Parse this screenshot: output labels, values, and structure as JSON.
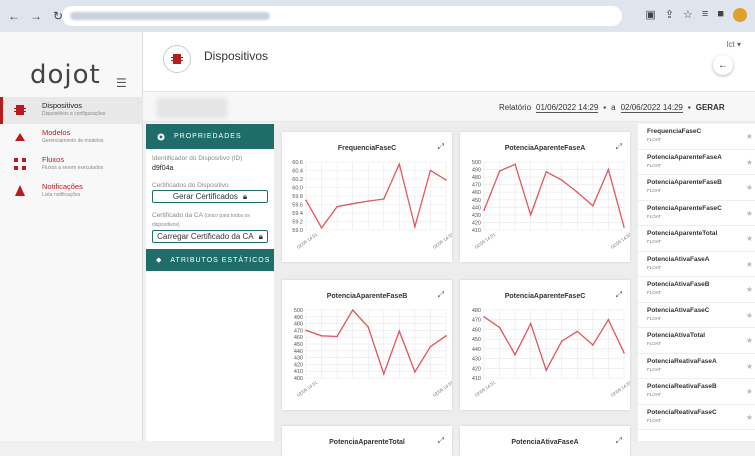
{
  "app": {
    "logo": "dojot",
    "page_title": "Dispositivos",
    "user": "lct"
  },
  "colors": {
    "accent": "#b71c1c",
    "teal": "#1e6d6a",
    "line": "#e0575d"
  },
  "sidebar": {
    "items": [
      {
        "title": "Dispositivos",
        "subtitle": "Dispositivos e configurações",
        "icon": "device-icon",
        "active": true
      },
      {
        "title": "Modelos",
        "subtitle": "Gerenciamento de modelos",
        "icon": "model-icon"
      },
      {
        "title": "Fluxos",
        "subtitle": "Fluxos a serem executados",
        "icon": "flow-icon"
      },
      {
        "title": "Notificações",
        "subtitle": "Lista notificações",
        "icon": "notification-icon"
      }
    ]
  },
  "report": {
    "label": "Relatório",
    "start": "01/06/2022 14:29",
    "separator": "a",
    "end": "02/06/2022 14:29",
    "action": "GERAR"
  },
  "properties": {
    "header": "PROPRIEDADES",
    "id_label": "Identificador do Dispositivo (ID)",
    "id_value": "d9f04a",
    "certs_label": "Certificados do Dispositivo",
    "gen_certs": "Gerar Certificados",
    "ca_label": "Certificado da CA",
    "ca_note": "(único para todos os dispositivos)",
    "load_ca": "Carregar Certificado da CA",
    "static_header": "ATRIBUTOS ESTÁTICOS"
  },
  "chart_data": [
    {
      "type": "line",
      "title": "FrequenciaFaseC",
      "x_ticks": [
        "02/06 14:51",
        "02/06 14:52"
      ],
      "ylim": [
        59.0,
        60.6
      ],
      "y_ticks": [
        59.0,
        59.2,
        59.4,
        59.6,
        59.8,
        60.0,
        60.2,
        60.4,
        60.6
      ],
      "values": [
        59.7,
        59.05,
        59.55,
        59.62,
        59.68,
        59.73,
        60.55,
        59.08,
        60.4,
        60.18
      ]
    },
    {
      "type": "line",
      "title": "PotenciaAparenteFaseA",
      "x_ticks": [
        "02/06 14:51",
        "02/06 14:52"
      ],
      "ylim": [
        410,
        500
      ],
      "y_ticks": [
        410,
        420,
        430,
        440,
        450,
        460,
        470,
        480,
        490,
        500
      ],
      "values": [
        436,
        488,
        497,
        430,
        487,
        476,
        460,
        442,
        490,
        414
      ]
    },
    {
      "type": "line",
      "title": "PotenciaAparenteFaseB",
      "x_ticks": [
        "02/06 14:51",
        "02/06 14:52"
      ],
      "ylim": [
        400,
        500
      ],
      "y_ticks": [
        400,
        410,
        420,
        430,
        440,
        450,
        460,
        470,
        480,
        490,
        500
      ],
      "values": [
        470,
        462,
        461,
        500,
        475,
        406,
        469,
        409,
        446,
        462
      ]
    },
    {
      "type": "line",
      "title": "PotenciaAparenteFaseC",
      "x_ticks": [
        "02/06 14:51",
        "02/06 14:52"
      ],
      "ylim": [
        410,
        480
      ],
      "y_ticks": [
        410,
        420,
        430,
        440,
        450,
        460,
        470,
        480
      ],
      "values": [
        473,
        462,
        434,
        466,
        418,
        448,
        458,
        444,
        470,
        436
      ]
    },
    {
      "type": "line",
      "title": "PotenciaAparenteTotal",
      "x_ticks": [],
      "values": []
    },
    {
      "type": "line",
      "title": "PotenciaAtivaFaseA",
      "x_ticks": [],
      "values": []
    }
  ],
  "attributes": [
    {
      "name": "FrequenciaFaseC",
      "type": "FLOAT"
    },
    {
      "name": "PotenciaAparenteFaseA",
      "type": "FLOAT"
    },
    {
      "name": "PotenciaAparenteFaseB",
      "type": "FLOAT"
    },
    {
      "name": "PotenciaAparenteFaseC",
      "type": "FLOAT"
    },
    {
      "name": "PotenciaAparenteTotal",
      "type": "FLOAT"
    },
    {
      "name": "PotenciaAtivaFaseA",
      "type": "FLOAT"
    },
    {
      "name": "PotenciaAtivaFaseB",
      "type": "FLOAT"
    },
    {
      "name": "PotenciaAtivaFaseC",
      "type": "FLOAT"
    },
    {
      "name": "PotenciaAtivaTotal",
      "type": "FLOAT"
    },
    {
      "name": "PotenciaReativaFaseA",
      "type": "FLOAT"
    },
    {
      "name": "PotenciaReativaFaseB",
      "type": "FLOAT"
    },
    {
      "name": "PotenciaReativaFaseC",
      "type": "FLOAT"
    }
  ]
}
